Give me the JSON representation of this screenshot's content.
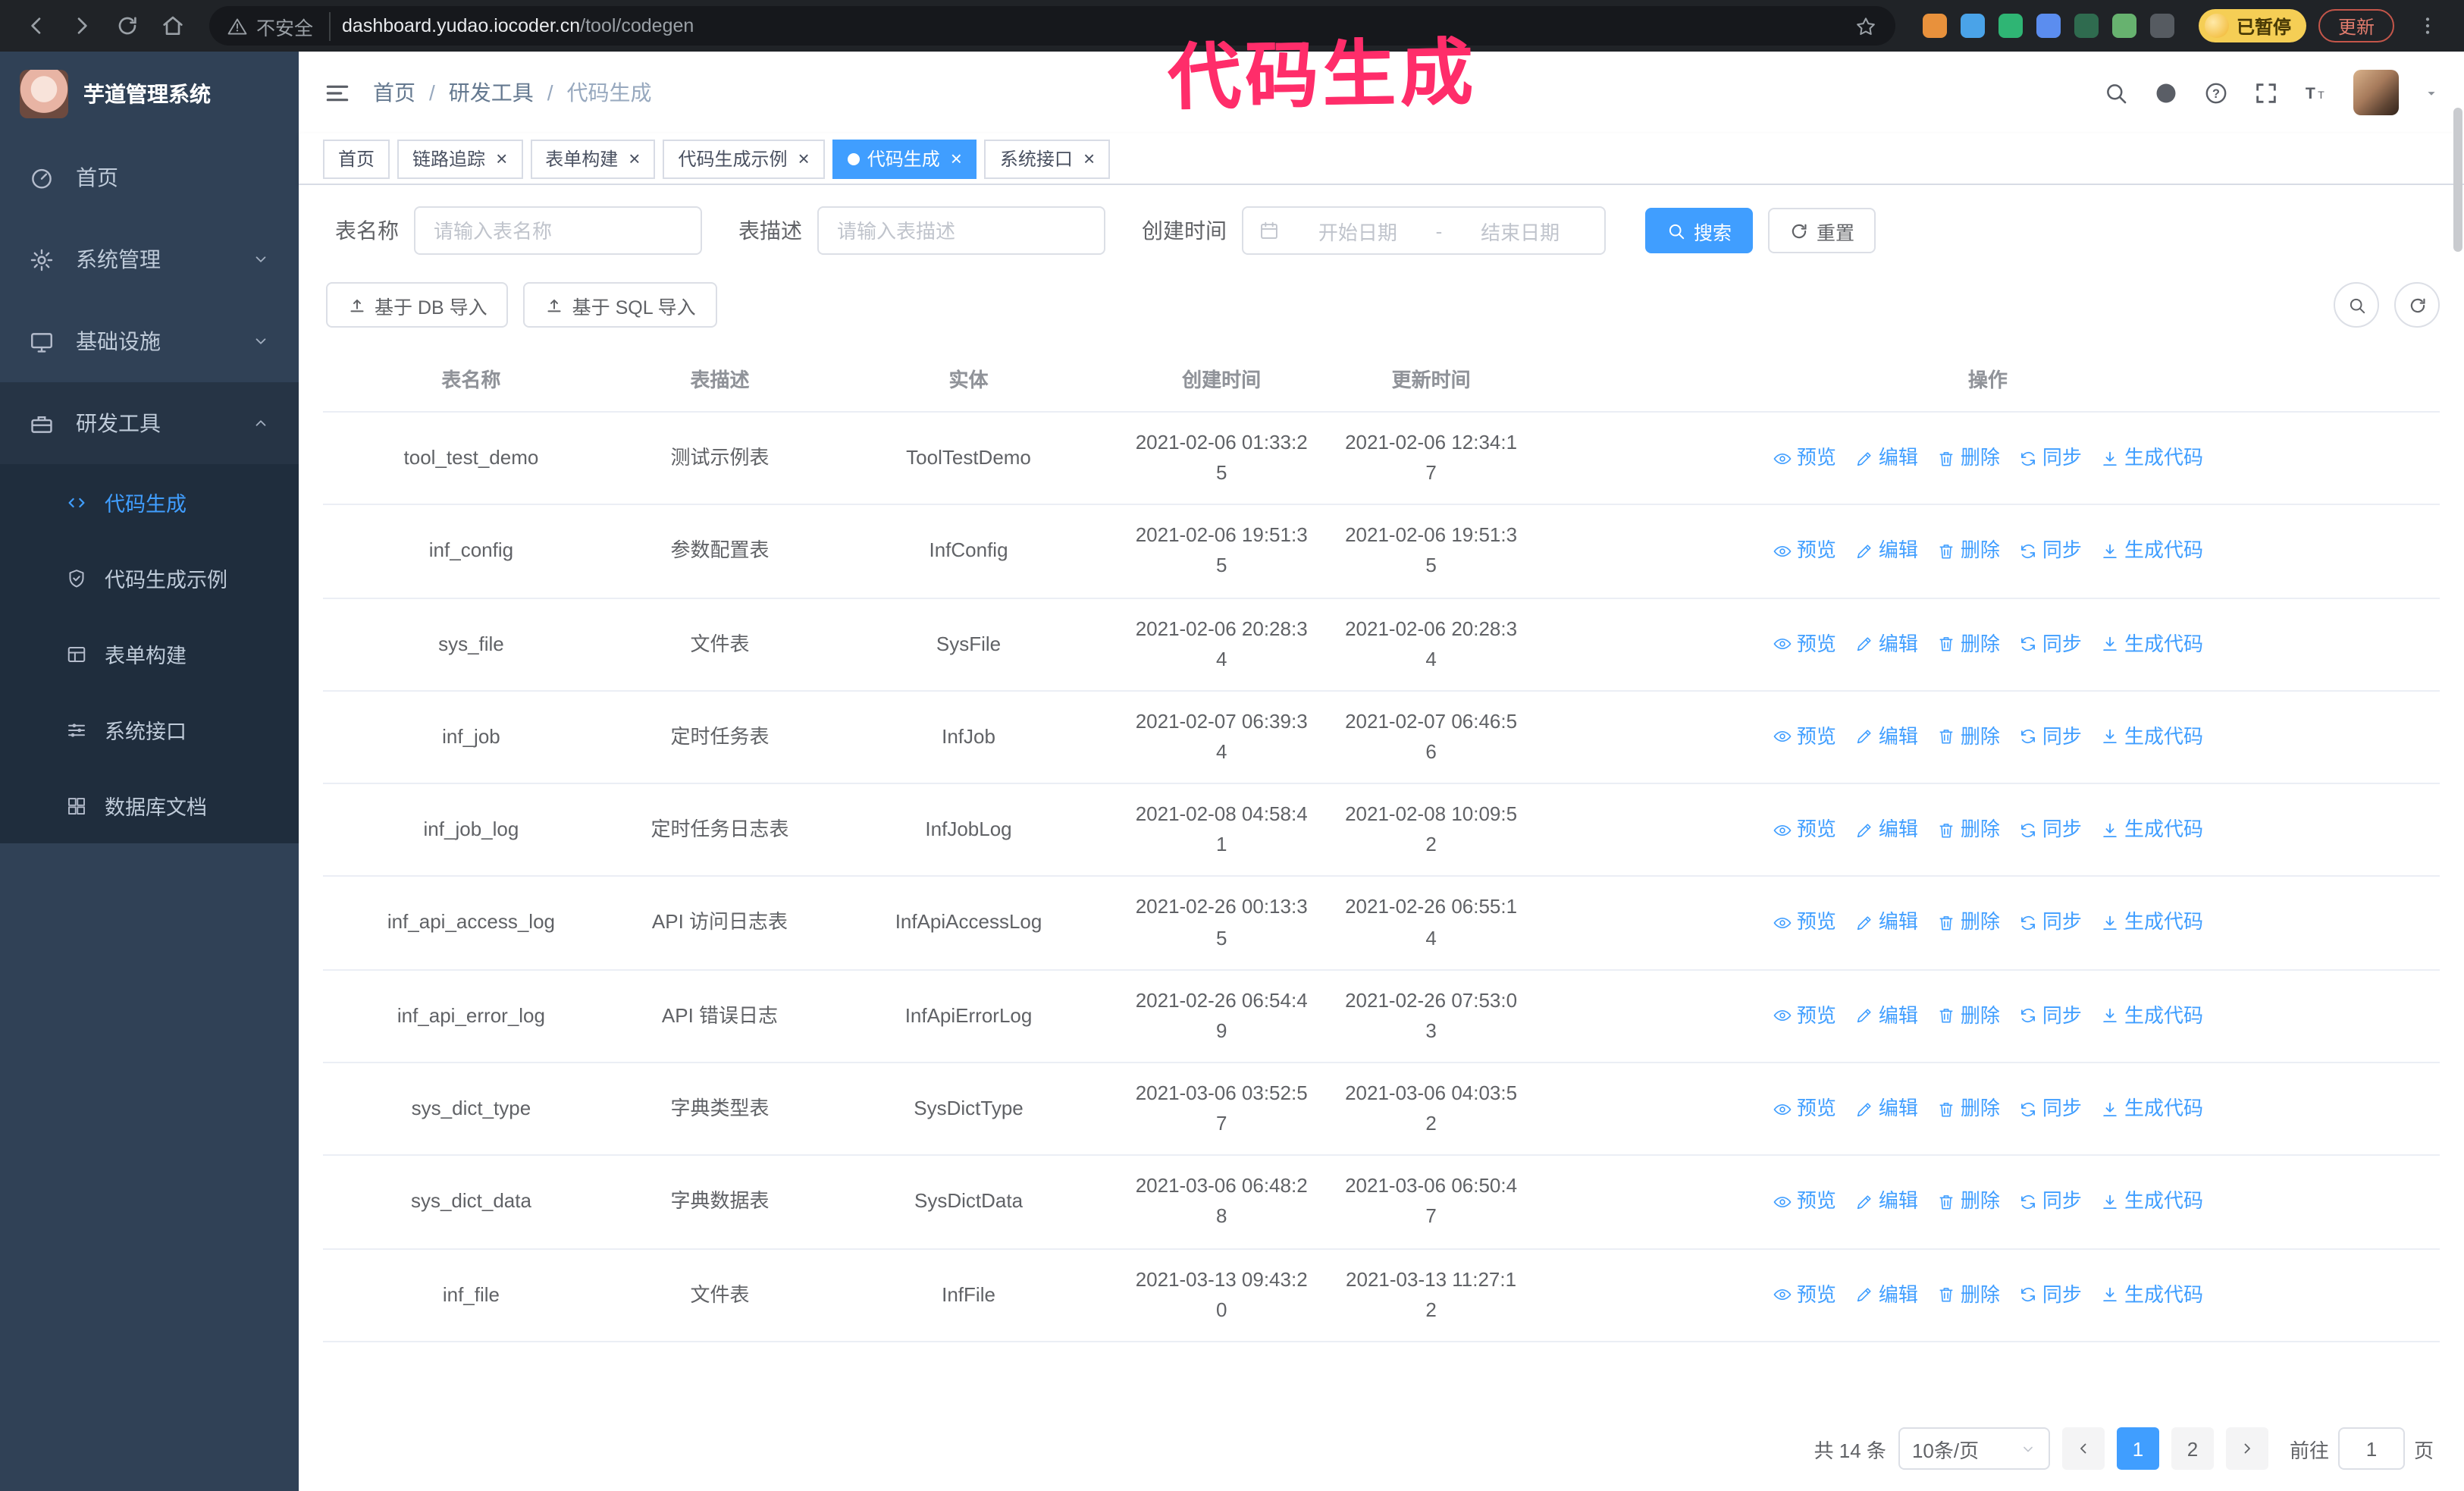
{
  "theme": {
    "accent": "#409eff",
    "sidebar_bg": "#304156",
    "submenu_bg": "#1f2d3d",
    "annotation_color": "#ff2d6a"
  },
  "annotation": {
    "text": "代码生成"
  },
  "browser": {
    "security_label": "不安全",
    "url_domain": "dashboard.yudao.iocoder.cn",
    "url_path": "/tool/codegen",
    "paused_badge": "已暂停",
    "update_button": "更新",
    "extensions": [
      {
        "name": "ext-orange",
        "color": "#e8913c"
      },
      {
        "name": "ext-blue-drop",
        "color": "#4aa3e8"
      },
      {
        "name": "ext-green-check",
        "color": "#2fb574"
      },
      {
        "name": "ext-blue-people",
        "color": "#5b8def"
      },
      {
        "name": "ext-dark-green",
        "color": "#2f6b4f"
      },
      {
        "name": "ext-green-leaf",
        "color": "#67b26f"
      },
      {
        "name": "ext-puzzle",
        "color": "#565b61"
      }
    ]
  },
  "sidebar": {
    "logo_title": "芋道管理系统",
    "items": [
      {
        "id": "home",
        "label": "首页",
        "icon": "dashboard-icon",
        "expandable": false,
        "expanded": false,
        "children": []
      },
      {
        "id": "system-manage",
        "label": "系统管理",
        "icon": "gear-icon",
        "expandable": true,
        "expanded": false,
        "children": []
      },
      {
        "id": "infrastructure",
        "label": "基础设施",
        "icon": "monitor-icon",
        "expandable": true,
        "expanded": false,
        "children": []
      },
      {
        "id": "dev-tools",
        "label": "研发工具",
        "icon": "toolbox-icon",
        "expandable": true,
        "expanded": true,
        "children": [
          {
            "id": "codegen",
            "label": "代码生成",
            "icon": "code-icon",
            "active": true
          },
          {
            "id": "codegen-example",
            "label": "代码生成示例",
            "icon": "shield-icon",
            "active": false
          },
          {
            "id": "form-build",
            "label": "表单构建",
            "icon": "form-icon",
            "active": false
          },
          {
            "id": "api",
            "label": "系统接口",
            "icon": "sliders-icon",
            "active": false
          },
          {
            "id": "db-doc",
            "label": "数据库文档",
            "icon": "grid-icon",
            "active": false
          }
        ]
      }
    ]
  },
  "header": {
    "breadcrumb": [
      "首页",
      "研发工具",
      "代码生成"
    ]
  },
  "tabs": [
    {
      "id": "home",
      "label": "首页",
      "closable": false,
      "active": false
    },
    {
      "id": "tracer",
      "label": "链路追踪",
      "closable": true,
      "active": false
    },
    {
      "id": "form-build",
      "label": "表单构建",
      "closable": true,
      "active": false
    },
    {
      "id": "codegen-example",
      "label": "代码生成示例",
      "closable": true,
      "active": false
    },
    {
      "id": "codegen",
      "label": "代码生成",
      "closable": true,
      "active": true
    },
    {
      "id": "api",
      "label": "系统接口",
      "closable": true,
      "active": false
    }
  ],
  "filters": {
    "table_name_label": "表名称",
    "table_name_placeholder": "请输入表名称",
    "table_desc_label": "表描述",
    "table_desc_placeholder": "请输入表描述",
    "create_time_label": "创建时间",
    "date_start_placeholder": "开始日期",
    "date_separator": "-",
    "date_end_placeholder": "结束日期",
    "search_label": "搜索",
    "reset_label": "重置"
  },
  "toolbar": {
    "import_db_label": "基于 DB 导入",
    "import_sql_label": "基于 SQL 导入"
  },
  "table": {
    "columns": [
      "表名称",
      "表描述",
      "实体",
      "创建时间",
      "更新时间",
      "操作"
    ],
    "action_labels": [
      "预览",
      "编辑",
      "删除",
      "同步",
      "生成代码"
    ],
    "rows": [
      {
        "name": "tool_test_demo",
        "desc": "测试示例表",
        "entity": "ToolTestDemo",
        "created": "2021-02-06 01:33:25",
        "updated": "2021-02-06 12:34:17"
      },
      {
        "name": "inf_config",
        "desc": "参数配置表",
        "entity": "InfConfig",
        "created": "2021-02-06 19:51:35",
        "updated": "2021-02-06 19:51:35"
      },
      {
        "name": "sys_file",
        "desc": "文件表",
        "entity": "SysFile",
        "created": "2021-02-06 20:28:34",
        "updated": "2021-02-06 20:28:34"
      },
      {
        "name": "inf_job",
        "desc": "定时任务表",
        "entity": "InfJob",
        "created": "2021-02-07 06:39:34",
        "updated": "2021-02-07 06:46:56"
      },
      {
        "name": "inf_job_log",
        "desc": "定时任务日志表",
        "entity": "InfJobLog",
        "created": "2021-02-08 04:58:41",
        "updated": "2021-02-08 10:09:52"
      },
      {
        "name": "inf_api_access_log",
        "desc": "API 访问日志表",
        "entity": "InfApiAccessLog",
        "created": "2021-02-26 00:13:35",
        "updated": "2021-02-26 06:55:14"
      },
      {
        "name": "inf_api_error_log",
        "desc": "API 错误日志",
        "entity": "InfApiErrorLog",
        "created": "2021-02-26 06:54:49",
        "updated": "2021-02-26 07:53:03"
      },
      {
        "name": "sys_dict_type",
        "desc": "字典类型表",
        "entity": "SysDictType",
        "created": "2021-03-06 03:52:57",
        "updated": "2021-03-06 04:03:52"
      },
      {
        "name": "sys_dict_data",
        "desc": "字典数据表",
        "entity": "SysDictData",
        "created": "2021-03-06 06:48:28",
        "updated": "2021-03-06 06:50:47"
      },
      {
        "name": "inf_file",
        "desc": "文件表",
        "entity": "InfFile",
        "created": "2021-03-13 09:43:20",
        "updated": "2021-03-13 11:27:12"
      }
    ]
  },
  "pagination": {
    "total_label": "共 14 条",
    "page_size_label": "10条/页",
    "pages": [
      "1",
      "2"
    ],
    "active_page": "1",
    "goto_label": "前往",
    "goto_value": "1",
    "goto_unit": "页"
  }
}
